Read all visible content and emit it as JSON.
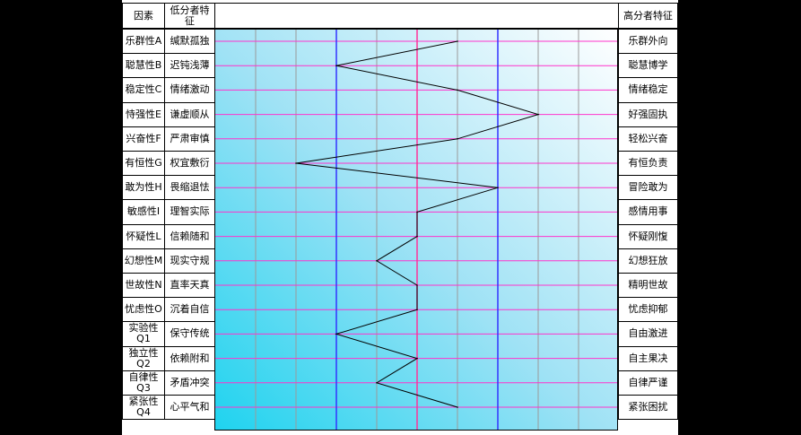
{
  "header": {
    "factor": "因素",
    "low": "低分者特征",
    "high": "高分者特征"
  },
  "chart_data": {
    "type": "line",
    "xlim": [
      0,
      10
    ],
    "y_categories": [
      "乐群性A",
      "聪慧性B",
      "稳定性C",
      "恃强性E",
      "兴奋性F",
      "有恒性G",
      "敢为性H",
      "敏感性I",
      "怀疑性L",
      "幻想性M",
      "世故性N",
      "忧虑性O",
      "实验性Q1",
      "独立性Q2",
      "自律性Q3",
      "紧张性Q4"
    ],
    "values": [
      6,
      3,
      6,
      8,
      6,
      2,
      7,
      5,
      5,
      4,
      5,
      5,
      3,
      5,
      4,
      6
    ],
    "low_traits": [
      "缄默孤独",
      "迟钝浅薄",
      "情绪激动",
      "谦虚顺从",
      "严肃审慎",
      "权宜敷衍",
      "畏缩退怯",
      "理智实际",
      "信赖随和",
      "现实守规",
      "直率天真",
      "沉着自信",
      "保守传统",
      "依赖附和",
      "矛盾冲突",
      "心平气和"
    ],
    "high_traits": [
      "乐群外向",
      "聪慧博学",
      "情绪稳定",
      "好强固执",
      "轻松兴奋",
      "有恒负责",
      "冒险敢为",
      "感情用事",
      "怀疑刚愎",
      "幻想狂放",
      "精明世故",
      "忧虑抑郁",
      "自由激进",
      "自主果决",
      "自律严谨",
      "紧张困扰"
    ],
    "reference_lines": [
      {
        "x": 3,
        "color": "#3333ff"
      },
      {
        "x": 5,
        "color": "#ff3399"
      },
      {
        "x": 7,
        "color": "#3333ff"
      }
    ],
    "colors": {
      "grid_vertical": "#9a9a9a",
      "grid_horizontal": "#ff33cc",
      "line": "#000000",
      "background_from": "#1fd3ef",
      "background_to": "#ffffff"
    },
    "grid": true
  }
}
